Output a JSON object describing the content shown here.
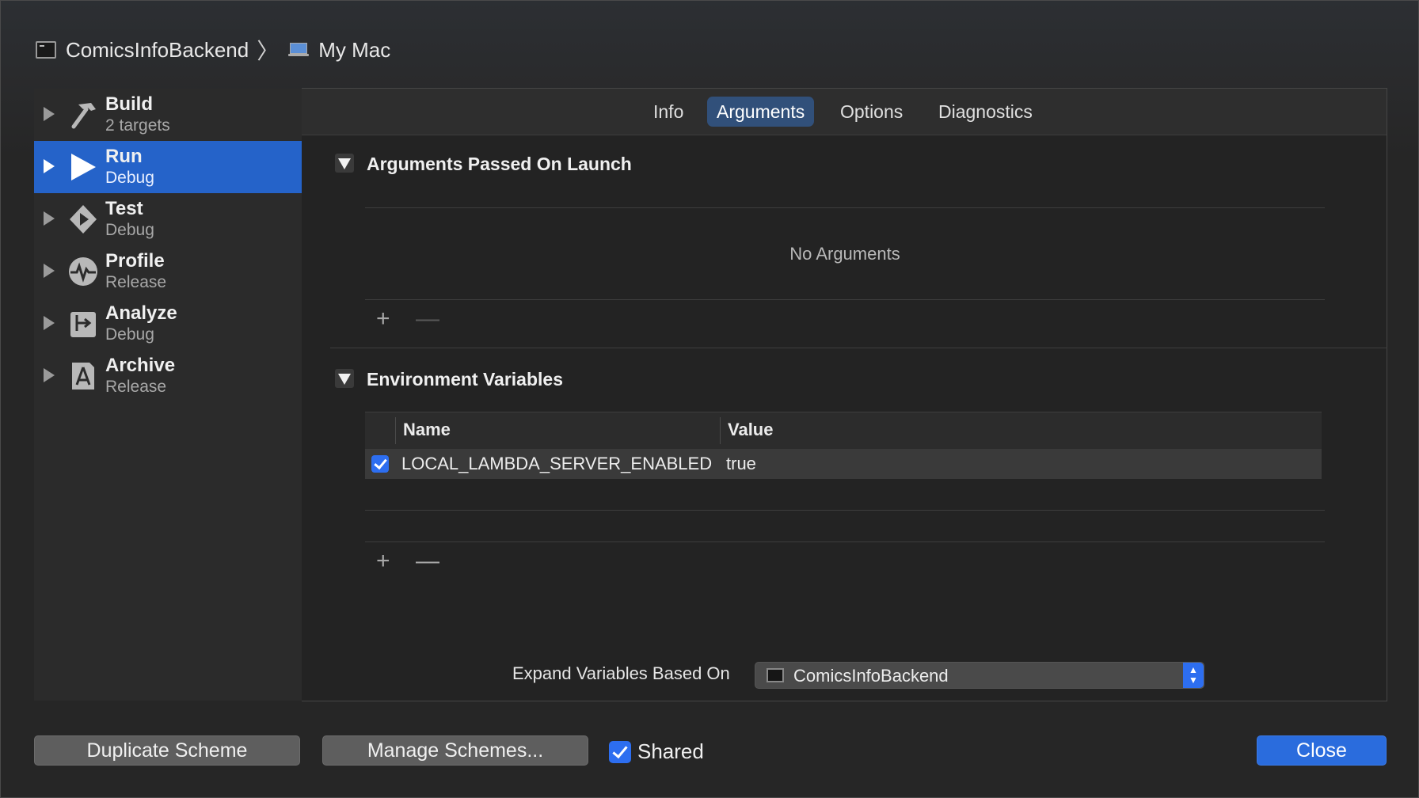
{
  "header": {
    "scheme": "ComicsInfoBackend",
    "separator": "〉",
    "destination": "My Mac"
  },
  "sidebar": {
    "items": [
      {
        "title": "Build",
        "subtitle": "2 targets",
        "icon": "hammer-icon",
        "selected": false
      },
      {
        "title": "Run",
        "subtitle": "Debug",
        "icon": "play-icon",
        "selected": true
      },
      {
        "title": "Test",
        "subtitle": "Debug",
        "icon": "test-diamond-icon",
        "selected": false
      },
      {
        "title": "Profile",
        "subtitle": "Release",
        "icon": "waveform-icon",
        "selected": false
      },
      {
        "title": "Analyze",
        "subtitle": "Debug",
        "icon": "analyze-icon",
        "selected": false
      },
      {
        "title": "Archive",
        "subtitle": "Release",
        "icon": "archive-icon",
        "selected": false
      }
    ]
  },
  "tabs": [
    {
      "label": "Info",
      "active": false
    },
    {
      "label": "Arguments",
      "active": true
    },
    {
      "label": "Options",
      "active": false
    },
    {
      "label": "Diagnostics",
      "active": false
    }
  ],
  "arguments": {
    "title": "Arguments Passed On Launch",
    "empty_text": "No Arguments",
    "add_label": "+",
    "remove_label": "—"
  },
  "environment": {
    "title": "Environment Variables",
    "columns": [
      "Name",
      "Value"
    ],
    "rows": [
      {
        "enabled": true,
        "name": "LOCAL_LAMBDA_SERVER_ENABLED",
        "value": "true"
      }
    ],
    "add_label": "+",
    "remove_label": "—"
  },
  "expand": {
    "label": "Expand Variables Based On",
    "selected": "ComicsInfoBackend"
  },
  "footer": {
    "duplicate": "Duplicate Scheme",
    "manage": "Manage Schemes...",
    "shared_label": "Shared",
    "shared_checked": true,
    "close": "Close"
  },
  "colors": {
    "accent": "#2563c9",
    "checkbox": "#2d6ef0",
    "tab_active": "#31507a"
  }
}
